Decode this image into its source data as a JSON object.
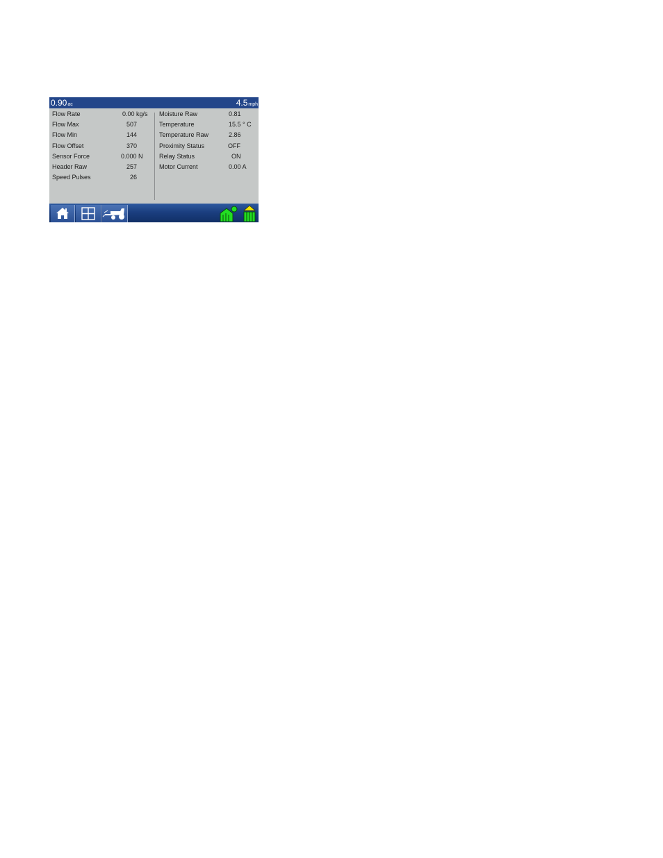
{
  "topbar": {
    "area_value": "0.90",
    "area_unit": "ac",
    "speed_value": "4.5",
    "speed_unit": "mph"
  },
  "left_readings": [
    {
      "label": "Flow Rate",
      "value": "0.00 kg/s"
    },
    {
      "label": "Flow Max",
      "value": "507"
    },
    {
      "label": "Flow Min",
      "value": "144"
    },
    {
      "label": "Flow Offset",
      "value": "370"
    },
    {
      "label": "Sensor Force",
      "value": "0.000 N"
    },
    {
      "label": "Header Raw",
      "value": "257"
    },
    {
      "label": "Speed Pulses",
      "value": "26"
    }
  ],
  "right_readings": [
    {
      "label": "Moisture Raw",
      "value": "0.81"
    },
    {
      "label": "Temperature",
      "value": "15.5 ° C"
    },
    {
      "label": "Temperature Raw",
      "value": "2.86"
    },
    {
      "label": "Proximity Status",
      "value": "OFF"
    },
    {
      "label": "Relay Status",
      "value": "ON"
    },
    {
      "label": "Motor Current",
      "value": "0.00 A"
    }
  ],
  "bottombar": {
    "buttons": [
      "home-icon",
      "grid-layout-icon",
      "combine-harvester-icon"
    ],
    "status_icons": [
      "field-logging-icon",
      "header-up-icon"
    ]
  },
  "colors": {
    "topbar": "#23468a",
    "panel": "#c5c8c7",
    "status_green": "#22dd22",
    "status_yellow": "#f2e600"
  }
}
